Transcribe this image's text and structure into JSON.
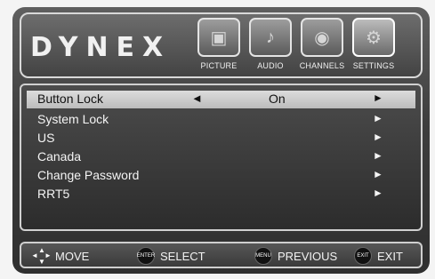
{
  "header": {
    "brand": "DYNEX",
    "tabs": [
      {
        "label": "PICTURE",
        "icon": "picture-icon",
        "active": false
      },
      {
        "label": "AUDIO",
        "icon": "audio-icon",
        "active": false
      },
      {
        "label": "CHANNELS",
        "icon": "channels-icon",
        "active": false
      },
      {
        "label": "SETTINGS",
        "icon": "settings-icon",
        "active": true
      }
    ]
  },
  "menu": {
    "items": [
      {
        "label": "Button Lock",
        "value": "On",
        "selected": true
      },
      {
        "label": "System Lock",
        "value": "",
        "selected": false
      },
      {
        "label": "US",
        "value": "",
        "selected": false
      },
      {
        "label": "Canada",
        "value": "",
        "selected": false
      },
      {
        "label": "Change Password",
        "value": "",
        "selected": false
      },
      {
        "label": "RRT5",
        "value": "",
        "selected": false
      }
    ]
  },
  "footer": {
    "move": {
      "text": "MOVE",
      "icon": "dpad-icon"
    },
    "select": {
      "badge": "ENTER",
      "text": "SELECT"
    },
    "previous": {
      "badge": "MENU",
      "text": "PREVIOUS"
    },
    "exit": {
      "badge": "EXIT",
      "text": "EXIT"
    }
  }
}
